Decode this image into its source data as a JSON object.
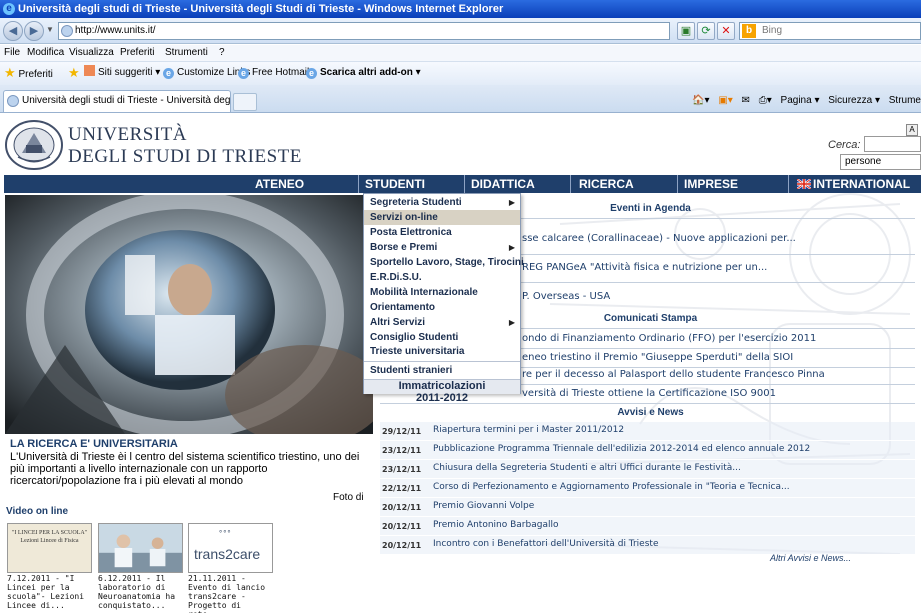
{
  "window": {
    "title": "Università degli studi di Trieste - Università degli Studi di Trieste - Windows Internet Explorer"
  },
  "address": {
    "url": "http://www.units.it/",
    "search_placeholder": "Bing"
  },
  "menubar": [
    "File",
    "Modifica",
    "Visualizza",
    "Preferiti",
    "Strumenti",
    "?"
  ],
  "favorites": {
    "preferiti": "Preferiti",
    "items": [
      "Siti suggeriti ▾",
      "Customize Links",
      "Free Hotmail",
      "Scarica altri add-on ▾"
    ]
  },
  "tab": {
    "title": "Università degli studi di Trieste - Università degli Studi ..."
  },
  "commandbar": [
    "Pagina ▾",
    "Sicurezza ▾",
    "Strume"
  ],
  "header": {
    "univ_line1": "UNIVERSITÀ",
    "univ_line2": "DEGLI STUDI DI TRIESTE",
    "a_button": "A",
    "cerca_label": "Cerca:",
    "search_scope": "persone"
  },
  "nav": {
    "items": [
      "ATENEO",
      "STUDENTI",
      "DIDATTICA",
      "RICERCA",
      "IMPRESE",
      "INTERNATIONAL"
    ]
  },
  "studenti_menu": {
    "items": [
      {
        "label": "Segreteria Studenti",
        "sub": true
      },
      {
        "label": "Servizi on-line",
        "sub": false
      },
      {
        "label": "Posta Elettronica",
        "sub": false
      },
      {
        "label": "Borse e Premi",
        "sub": true
      },
      {
        "label": "Sportello Lavoro, Stage, Tirocini",
        "sub": false
      },
      {
        "label": "E.R.Di.S.U.",
        "sub": false
      },
      {
        "label": "Mobilità Internazionale",
        "sub": false
      },
      {
        "label": "Orientamento",
        "sub": false
      },
      {
        "label": "Altri Servizi",
        "sub": true
      },
      {
        "label": "Consiglio Studenti",
        "sub": false
      },
      {
        "label": "Trieste universitaria",
        "sub": false
      },
      {
        "label": "Studenti stranieri",
        "sub": false
      }
    ],
    "immatricolazioni_line1": "Immatricolazioni",
    "immatricolazioni_line2": "2011-2012"
  },
  "ricerca": {
    "title": "LA RICERCA E' UNIVERSITARIA",
    "text": "L'Università di Trieste èi l centro del sistema scientifico triestino, uno dei più importanti a livello internazionale con un rapporto ricercatori/popolazione fra i più elevati al mondo",
    "foto": "Foto di"
  },
  "video": {
    "title": "Video on line",
    "thumb1_line1": "\"I LINCEI PER LA SCUOLA\"",
    "thumb1_line2": "Lezioni Lincee di Fisica",
    "thumb3_text": "trans2care",
    "items": [
      "7.12.2011 - \"I Lincei per la scuola\"- Lezioni Lincee di...",
      "6.12.2011 - Il laboratorio di Neuroanatomia ha conquistato...",
      "21.11.2011 - Evento di lancio trans2care - Progetto di rete..."
    ]
  },
  "eventi": {
    "title": "Eventi in Agenda",
    "items": [
      "sse calcaree (Corallinaceae) - Nuove applicazioni per...",
      "REG PANGeA \"Attività fisica e nutrizione per un...",
      "P. Overseas - USA"
    ]
  },
  "comunicati": {
    "title": "Comunicati Stampa",
    "items": [
      "ondo di Finanziamento Ordinario (FFO) per l'esercizio 2011",
      "eneo triestino il Premio \"Giuseppe Sperduti\" della SIOI",
      "re per il decesso al Palasport dello studente Francesco Pinna",
      "versità di Trieste ottiene la Certificazione ISO 9001"
    ]
  },
  "avvisi": {
    "title": "Avvisi e News",
    "items": [
      {
        "date": "29/12/11",
        "title": "Riapertura termini per i Master 2011/2012"
      },
      {
        "date": "23/12/11",
        "title": "Pubblicazione Programma Triennale dell'edilizia 2012-2014 ed elenco annuale 2012"
      },
      {
        "date": "23/12/11",
        "title": "Chiusura della Segreteria Studenti e altri Uffici durante le Festività..."
      },
      {
        "date": "22/12/11",
        "title": "Corso di Perfezionamento e Aggiornamento Professionale in \"Teoria e Tecnica..."
      },
      {
        "date": "20/12/11",
        "title": "Premio Giovanni Volpe"
      },
      {
        "date": "20/12/11",
        "title": "Premio Antonino Barbagallo"
      },
      {
        "date": "20/12/11",
        "title": "Incontro con i Benefattori dell'Università di Trieste"
      }
    ],
    "more": "Altri Avvisi e News..."
  }
}
